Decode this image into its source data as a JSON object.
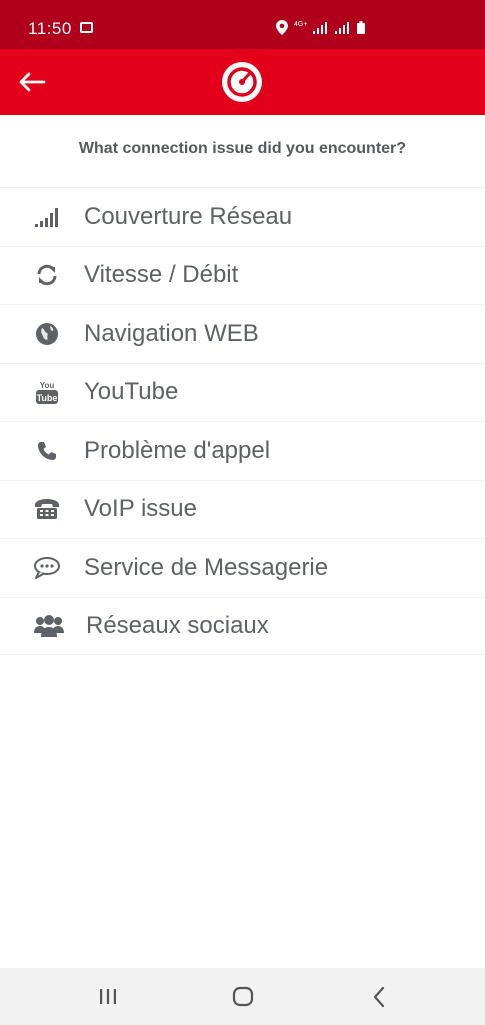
{
  "status_bar": {
    "time": "11:50",
    "network": "4G+"
  },
  "question": "What connection issue did you encounter?",
  "items": [
    {
      "label": "Couverture Réseau",
      "icon": "signal-bars-icon"
    },
    {
      "label": "Vitesse / Débit",
      "icon": "refresh-icon"
    },
    {
      "label": "Navigation WEB",
      "icon": "globe-icon"
    },
    {
      "label": "YouTube",
      "icon": "youtube-icon"
    },
    {
      "label": "Problème d'appel",
      "icon": "phone-icon"
    },
    {
      "label": "VoIP issue",
      "icon": "desk-phone-icon"
    },
    {
      "label": "Service de Messagerie",
      "icon": "chat-bubble-icon"
    },
    {
      "label": "Réseaux sociaux",
      "icon": "people-icon"
    }
  ],
  "colors": {
    "status_bar": "#b0001c",
    "app_bar": "#e2001a",
    "icon": "#5e6266"
  }
}
